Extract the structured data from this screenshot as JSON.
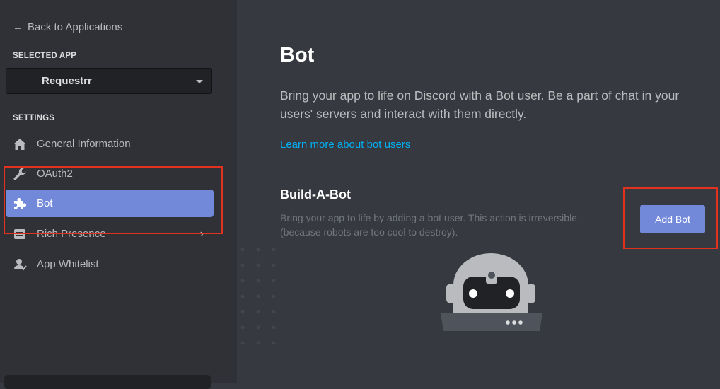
{
  "sidebar": {
    "back_label": "Back to Applications",
    "selected_app_heading": "SELECTED APP",
    "selected_app_value": "Requestrr",
    "settings_heading": "SETTINGS",
    "items": [
      {
        "label": "General Information",
        "icon": "home-icon"
      },
      {
        "label": "OAuth2",
        "icon": "wrench-icon"
      },
      {
        "label": "Bot",
        "icon": "puzzle-icon",
        "active": true
      },
      {
        "label": "Rich Presence",
        "icon": "rich-presence-icon",
        "has_submenu": true
      },
      {
        "label": "App Whitelist",
        "icon": "user-whitelist-icon"
      }
    ]
  },
  "main": {
    "title": "Bot",
    "description": "Bring your app to life on Discord with a Bot user. Be a part of chat in your users' servers and interact with them directly.",
    "learn_more": "Learn more about bot users",
    "build_title": "Build-A-Bot",
    "build_desc": "Bring your app to life by adding a bot user. This action is irreversible (because robots are too cool to destroy).",
    "add_bot_label": "Add Bot"
  },
  "colors": {
    "sidebar_bg": "#2f3136",
    "main_bg": "#36393f",
    "accent": "#7289da",
    "link": "#00b0f4",
    "annotation": "#e0321e"
  }
}
